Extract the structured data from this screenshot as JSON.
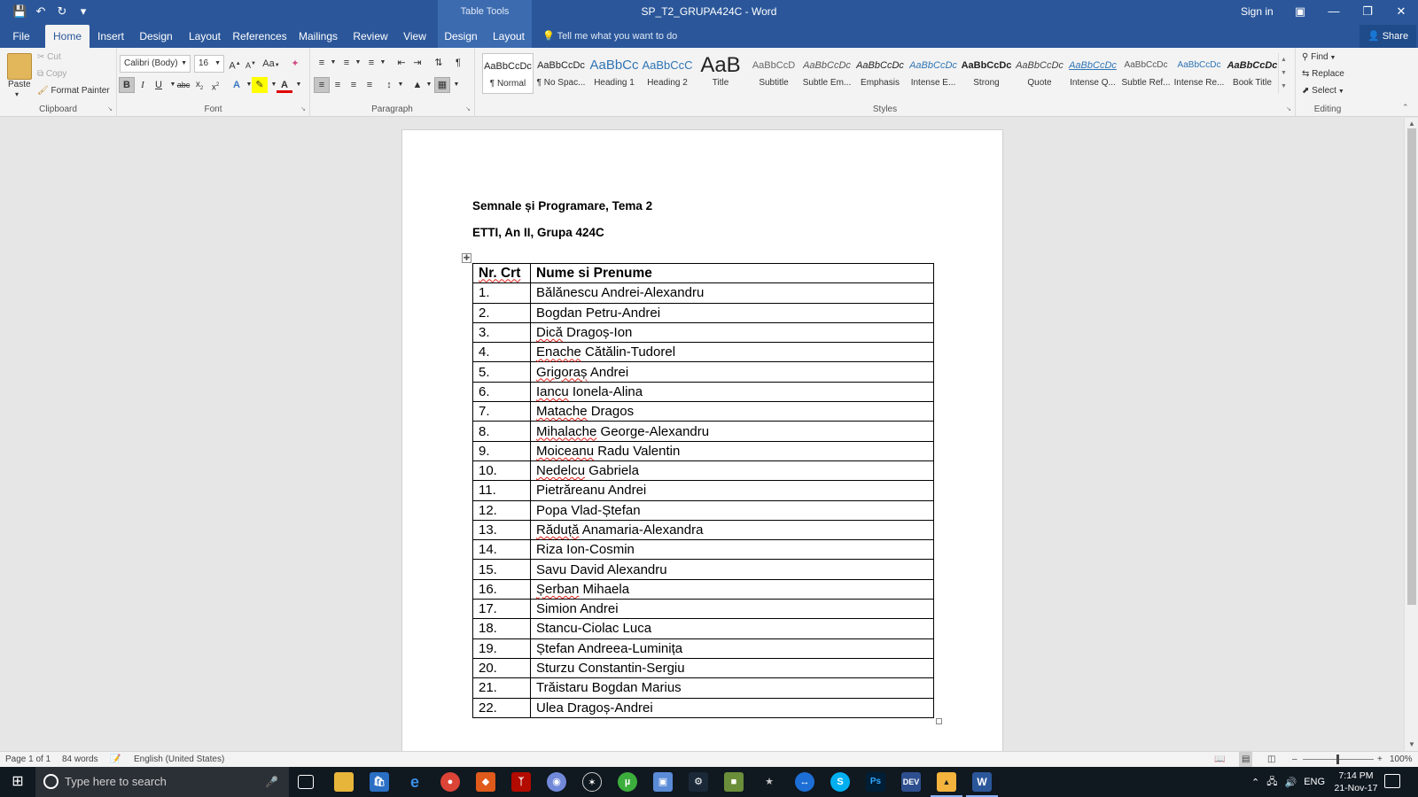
{
  "window": {
    "title": "SP_T2_GRUPA424C - Word",
    "contextual_label": "Table Tools",
    "sign_in": "Sign in"
  },
  "tabs": [
    "File",
    "Home",
    "Insert",
    "Design",
    "Layout",
    "References",
    "Mailings",
    "Review",
    "View",
    "Design",
    "Layout"
  ],
  "active_tab": "Home",
  "tell_me": "Tell me what you want to do",
  "share": "Share",
  "clipboard": {
    "paste": "Paste",
    "cut": "Cut",
    "copy": "Copy",
    "format_painter": "Format Painter",
    "label": "Clipboard"
  },
  "font": {
    "family": "Calibri (Body)",
    "size": "16",
    "label": "Font",
    "case_button": "Aa"
  },
  "paragraph": {
    "label": "Paragraph"
  },
  "styles": {
    "label": "Styles",
    "items": [
      {
        "preview": "AaBbCcDc",
        "name": "¶ Normal"
      },
      {
        "preview": "AaBbCcDc",
        "name": "¶ No Spac..."
      },
      {
        "preview": "AaBbCc",
        "name": "Heading 1"
      },
      {
        "preview": "AaBbCcC",
        "name": "Heading 2"
      },
      {
        "preview": "AaB",
        "name": "Title"
      },
      {
        "preview": "AaBbCcD",
        "name": "Subtitle"
      },
      {
        "preview": "AaBbCcDc",
        "name": "Subtle Em..."
      },
      {
        "preview": "AaBbCcDc",
        "name": "Emphasis"
      },
      {
        "preview": "AaBbCcDc",
        "name": "Intense E..."
      },
      {
        "preview": "AaBbCcDc",
        "name": "Strong"
      },
      {
        "preview": "AaBbCcDc",
        "name": "Quote"
      },
      {
        "preview": "AaBbCcDc",
        "name": "Intense Q..."
      },
      {
        "preview": "AaBbCcDc",
        "name": "Subtle Ref..."
      },
      {
        "preview": "AaBbCcDc",
        "name": "Intense Re..."
      },
      {
        "preview": "AaBbCcDc",
        "name": "Book Title"
      }
    ]
  },
  "editing": {
    "find": "Find",
    "replace": "Replace",
    "select": "Select",
    "label": "Editing"
  },
  "document": {
    "heading1": "Semnale și Programare, Tema 2",
    "heading2": "ETTI, An II, Grupa 424C",
    "table": {
      "headers": [
        "Nr. Crt",
        "Nume si Prenume"
      ],
      "rows": [
        [
          "1.",
          "Bălănescu Andrei-Alexandru"
        ],
        [
          "2.",
          "Bogdan Petru-Andrei"
        ],
        [
          "3.",
          "Dică Dragoș-Ion"
        ],
        [
          "4.",
          "Enache Cătălin-Tudorel"
        ],
        [
          "5.",
          "Grigoraș Andrei"
        ],
        [
          "6.",
          "Iancu Ionela-Alina"
        ],
        [
          "7.",
          "Matache Dragos"
        ],
        [
          "8.",
          "Mihalache George-Alexandru"
        ],
        [
          "9.",
          "Moiceanu Radu Valentin"
        ],
        [
          "10.",
          "Nedelcu Gabriela"
        ],
        [
          "11.",
          "Pietrăreanu Andrei"
        ],
        [
          "12.",
          "Popa Vlad-Ștefan"
        ],
        [
          "13.",
          "Răduță Anamaria-Alexandra"
        ],
        [
          "14.",
          "Riza Ion-Cosmin"
        ],
        [
          "15.",
          "Savu David Alexandru"
        ],
        [
          "16.",
          "Șerban Mihaela"
        ],
        [
          "17.",
          "Simion Andrei"
        ],
        [
          "18.",
          "Stancu-Ciolac Luca"
        ],
        [
          "19.",
          "Ștefan Andreea-Luminița"
        ],
        [
          "20.",
          "Sturzu Constantin-Sergiu"
        ],
        [
          "21.",
          "Trăistaru Bogdan Marius"
        ],
        [
          "22.",
          "Ulea Dragoș-Andrei"
        ]
      ]
    }
  },
  "status": {
    "page": "Page 1 of 1",
    "words": "84 words",
    "language": "English (United States)",
    "zoom": "100%"
  },
  "taskbar": {
    "search_placeholder": "Type here to search",
    "lang": "ENG",
    "time": "7:14 PM",
    "date": "21-Nov-17"
  }
}
